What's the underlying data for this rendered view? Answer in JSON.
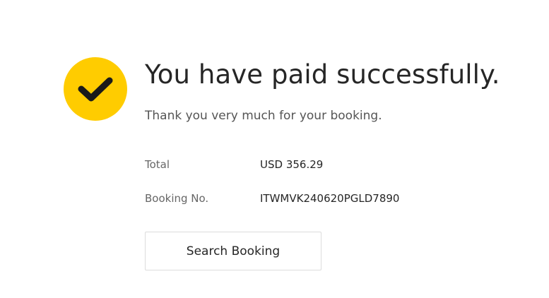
{
  "confirmation": {
    "icon": "checkmark-icon",
    "accent_color": "#ffcc00",
    "title": "You have paid successfully.",
    "subtitle": "Thank you very much for your booking."
  },
  "details": {
    "total_label": "Total",
    "total_value": "USD 356.29",
    "booking_label": "Booking No.",
    "booking_value": "ITWMVK240620PGLD7890"
  },
  "actions": {
    "search_label": "Search Booking"
  }
}
